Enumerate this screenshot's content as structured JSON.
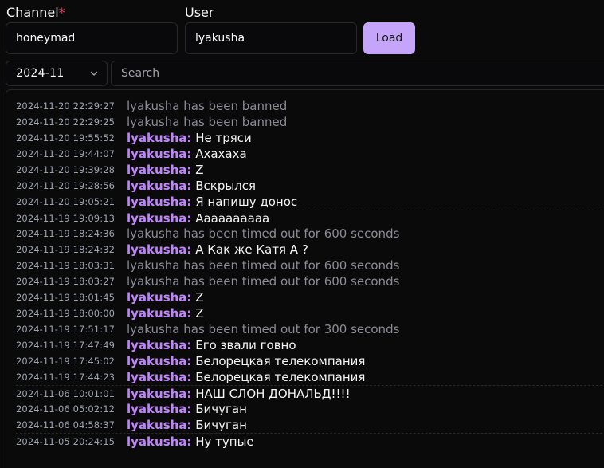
{
  "form": {
    "channel_label": "Channel",
    "required_mark": "*",
    "channel_value": "honeymad",
    "user_label": "User",
    "user_value": "lyakusha",
    "load_label": "Load",
    "month_value": "2024-11",
    "search_placeholder": "Search"
  },
  "colors": {
    "accent": "#c4a5fa",
    "username": "#c084fc",
    "required": "#f43f5e"
  },
  "messages": [
    {
      "time": "2024-11-20 22:29:27",
      "user": "",
      "text": "lyakusha has been banned",
      "system": true
    },
    {
      "time": "2024-11-20 22:29:25",
      "user": "",
      "text": "lyakusha has been banned",
      "system": true
    },
    {
      "time": "2024-11-20 19:55:52",
      "user": "lyakusha:",
      "text": "Не тряси",
      "system": false
    },
    {
      "time": "2024-11-20 19:44:07",
      "user": "lyakusha:",
      "text": "Ахахаха",
      "system": false
    },
    {
      "time": "2024-11-20 19:39:28",
      "user": "lyakusha:",
      "text": "Z",
      "system": false
    },
    {
      "time": "2024-11-20 19:28:56",
      "user": "lyakusha:",
      "text": "Вскрылся",
      "system": false
    },
    {
      "time": "2024-11-20 19:05:21",
      "user": "lyakusha:",
      "text": "Я напишу донос",
      "system": false
    },
    {
      "time": "2024-11-19 19:09:13",
      "user": "lyakusha:",
      "text": "Аааааааааа",
      "system": false
    },
    {
      "time": "2024-11-19 18:24:36",
      "user": "",
      "text": "lyakusha has been timed out for 600 seconds",
      "system": true
    },
    {
      "time": "2024-11-19 18:24:32",
      "user": "lyakusha:",
      "text": "А Как же Катя А ?",
      "system": false
    },
    {
      "time": "2024-11-19 18:03:31",
      "user": "",
      "text": "lyakusha has been timed out for 600 seconds",
      "system": true
    },
    {
      "time": "2024-11-19 18:03:27",
      "user": "",
      "text": "lyakusha has been timed out for 600 seconds",
      "system": true
    },
    {
      "time": "2024-11-19 18:01:45",
      "user": "lyakusha:",
      "text": "Z",
      "system": false
    },
    {
      "time": "2024-11-19 18:00:00",
      "user": "lyakusha:",
      "text": "Z",
      "system": false
    },
    {
      "time": "2024-11-19 17:51:17",
      "user": "",
      "text": "lyakusha has been timed out for 300 seconds",
      "system": true
    },
    {
      "time": "2024-11-19 17:47:49",
      "user": "lyakusha:",
      "text": "Его звали говно",
      "system": false
    },
    {
      "time": "2024-11-19 17:45:02",
      "user": "lyakusha:",
      "text": "Белорецкая телекомпания",
      "system": false
    },
    {
      "time": "2024-11-19 17:44:23",
      "user": "lyakusha:",
      "text": "Белорецкая телекомпания",
      "system": false
    },
    {
      "time": "2024-11-06 10:01:01",
      "user": "lyakusha:",
      "text": "НАШ СЛОН ДОНАЛЬД!!!!",
      "system": false
    },
    {
      "time": "2024-11-06 05:02:12",
      "user": "lyakusha:",
      "text": "Бичуган",
      "system": false
    },
    {
      "time": "2024-11-06 04:58:37",
      "user": "lyakusha:",
      "text": "Бичуган",
      "system": false
    },
    {
      "time": "2024-11-05 20:24:15",
      "user": "lyakusha:",
      "text": "Ну тупые",
      "system": false
    }
  ]
}
